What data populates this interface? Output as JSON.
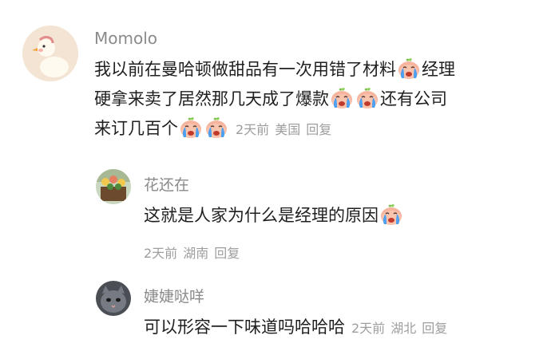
{
  "comments": [
    {
      "username": "Momolo",
      "lines": [
        "我以前在曼哈顿做甜品有一次用错了材料",
        "经理",
        "硬拿来卖了居然那几天成了爆款",
        "还有公司",
        "来订几百个"
      ],
      "time": "2天前",
      "location": "美国",
      "reply_label": "回复",
      "avatar_icon": "duck-avatar-icon"
    },
    {
      "username": "花还在",
      "lines": [
        "这就是人家为什么是经理的原因"
      ],
      "time": "2天前",
      "location": "湖南",
      "reply_label": "回复",
      "avatar_icon": "flower-avatar-icon"
    },
    {
      "username": "婕婕哒咩",
      "lines": [
        "可以形容一下味道吗哈哈哈"
      ],
      "time": "2天前",
      "location": "湖北",
      "reply_label": "回复",
      "avatar_icon": "cat-avatar-icon"
    }
  ],
  "emoji_name": "crying-face-emoji-icon",
  "colors": {
    "username": "#8a8a8a",
    "text": "#1f1f1f",
    "meta": "#9e9e9e",
    "emoji_face": "#f6b39d",
    "emoji_tear": "#4d9ff0",
    "emoji_leaf": "#7fbf4d"
  }
}
